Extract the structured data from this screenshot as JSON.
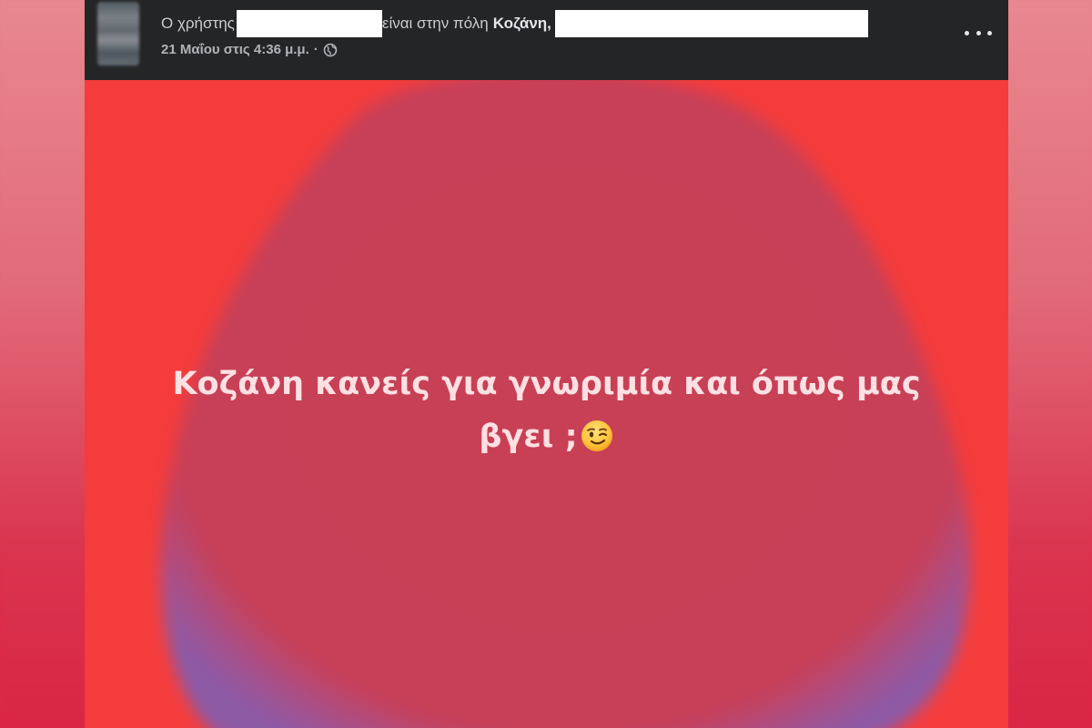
{
  "header": {
    "prefix": "Ο χρήστης",
    "middle": "είναι στην πόλη",
    "city": "Κοζάνη,",
    "timestamp": "21 Μαΐου στις 4:36 μ.μ.",
    "separator": "·",
    "privacy_icon": "globe-icon",
    "more_icon": "more-options-icon"
  },
  "post": {
    "text_line1": "Κοζάνη κανείς για γνωριμία και όπως μας",
    "text_line2": "βγει ;",
    "emoji": "winking-face-emoji",
    "background_color": "#f43c3c",
    "blob_color": "#c84058",
    "blob_edge_color": "#9a5aa0"
  }
}
